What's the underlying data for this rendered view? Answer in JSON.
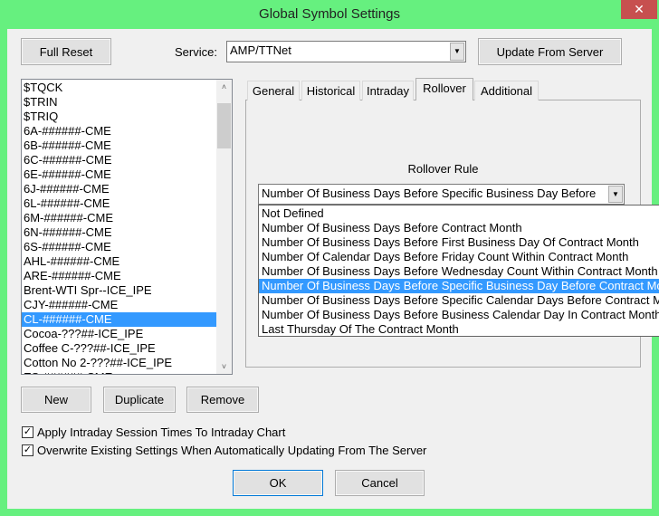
{
  "window": {
    "title": "Global Symbol Settings",
    "close": "✕"
  },
  "toolbar": {
    "full_reset": "Full Reset",
    "service_label": "Service:",
    "service_value": "AMP/TTNet",
    "update": "Update From Server"
  },
  "symbols": [
    "$TQCK",
    "$TRIN",
    "$TRIQ",
    "6A-######-CME",
    "6B-######-CME",
    "6C-######-CME",
    "6E-######-CME",
    "6J-######-CME",
    "6L-######-CME",
    "6M-######-CME",
    "6N-######-CME",
    "6S-######-CME",
    "AHL-######-CME",
    "ARE-######-CME",
    "Brent-WTI Spr--ICE_IPE",
    "CJY-######-CME",
    "CL-######-CME",
    "Cocoa-???##-ICE_IPE",
    "Coffee C-???##-ICE_IPE",
    "Cotton No 2-???##-ICE_IPE",
    "ES-######-CME"
  ],
  "selected_symbol": "CL-######-CME",
  "tabs": [
    "General",
    "Historical",
    "Intraday",
    "Rollover",
    "Additional"
  ],
  "active_tab": "Rollover",
  "rollover": {
    "label": "Rollover Rule",
    "value": "Number Of Business Days Before Specific Business Day Before",
    "options": [
      "Not Defined",
      "Number Of Business Days Before Contract Month",
      "Number Of Business Days Before First Business Day Of Contract Month",
      "Number Of Calendar Days Before Friday Count Within Contract Month",
      "Number Of Business Days Before Wednesday Count Within Contract Month",
      "Number Of Business Days Before Specific Business Day Before Contract Month",
      "Number Of Business Days Before Specific Calendar Days Before Contract Month",
      "Number Of Business Days Before Business Calendar Day In Contract Month",
      "Last Thursday Of The Contract Month"
    ],
    "selected_index": 5
  },
  "list_buttons": {
    "new": "New",
    "duplicate": "Duplicate",
    "remove": "Remove"
  },
  "options": {
    "apply_intraday": "Apply Intraday Session Times To Intraday Chart",
    "overwrite": "Overwrite Existing Settings When Automatically Updating From The Server",
    "apply_checked": true,
    "overwrite_checked": true,
    "check": "✓"
  },
  "footer": {
    "ok": "OK",
    "cancel": "Cancel"
  }
}
